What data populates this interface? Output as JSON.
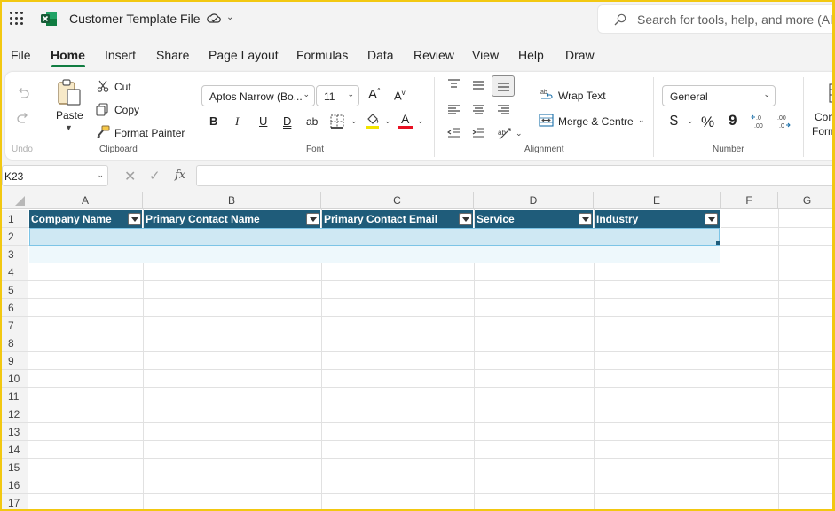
{
  "titlebar": {
    "doc_title": "Customer Template File",
    "search_placeholder": "Search for tools, help, and more (Alt"
  },
  "menu": [
    "File",
    "Home",
    "Insert",
    "Share",
    "Page Layout",
    "Formulas",
    "Data",
    "Review",
    "View",
    "Help",
    "Draw"
  ],
  "active_tab": "Home",
  "ribbon": {
    "undo_label": "Undo",
    "clipboard": {
      "paste": "Paste",
      "cut": "Cut",
      "copy": "Copy",
      "format_painter": "Format Painter",
      "label": "Clipboard"
    },
    "font": {
      "font_name": "Aptos Narrow (Bo...",
      "font_size": "11",
      "bold": "B",
      "italic": "I",
      "underline": "U",
      "double_underline": "D",
      "strike": "ab",
      "grow": "A",
      "shrink": "A",
      "font_color_glyph": "A",
      "label": "Font",
      "highlight_color": "#f2e400",
      "font_color": "#e81123"
    },
    "alignment": {
      "wrap_text": "Wrap Text",
      "merge_centre": "Merge & Centre",
      "label": "Alignment"
    },
    "number": {
      "format": "General",
      "currency": "$",
      "percent": "%",
      "comma": "9",
      "label": "Number"
    },
    "cond_format_1": "Con",
    "cond_format_2": "Form"
  },
  "formula_bar": {
    "name_box": "K23",
    "fx": "fx",
    "value": ""
  },
  "sheet": {
    "columns": [
      "A",
      "B",
      "C",
      "D",
      "E",
      "F",
      "G"
    ],
    "rows": [
      "1",
      "2",
      "3",
      "4",
      "5",
      "6",
      "7",
      "8",
      "9",
      "10",
      "11",
      "12",
      "13",
      "14",
      "15",
      "16",
      "17"
    ],
    "table_headers": [
      "Company Name",
      "Primary Contact Name",
      "Primary Contact Email",
      "Service",
      "Industry"
    ],
    "table_header_color": "#1f5c7a",
    "table_row_color": "#cfe8f3"
  },
  "colors": {
    "excel_green": "#107c41",
    "window_border": "#f2c811"
  }
}
